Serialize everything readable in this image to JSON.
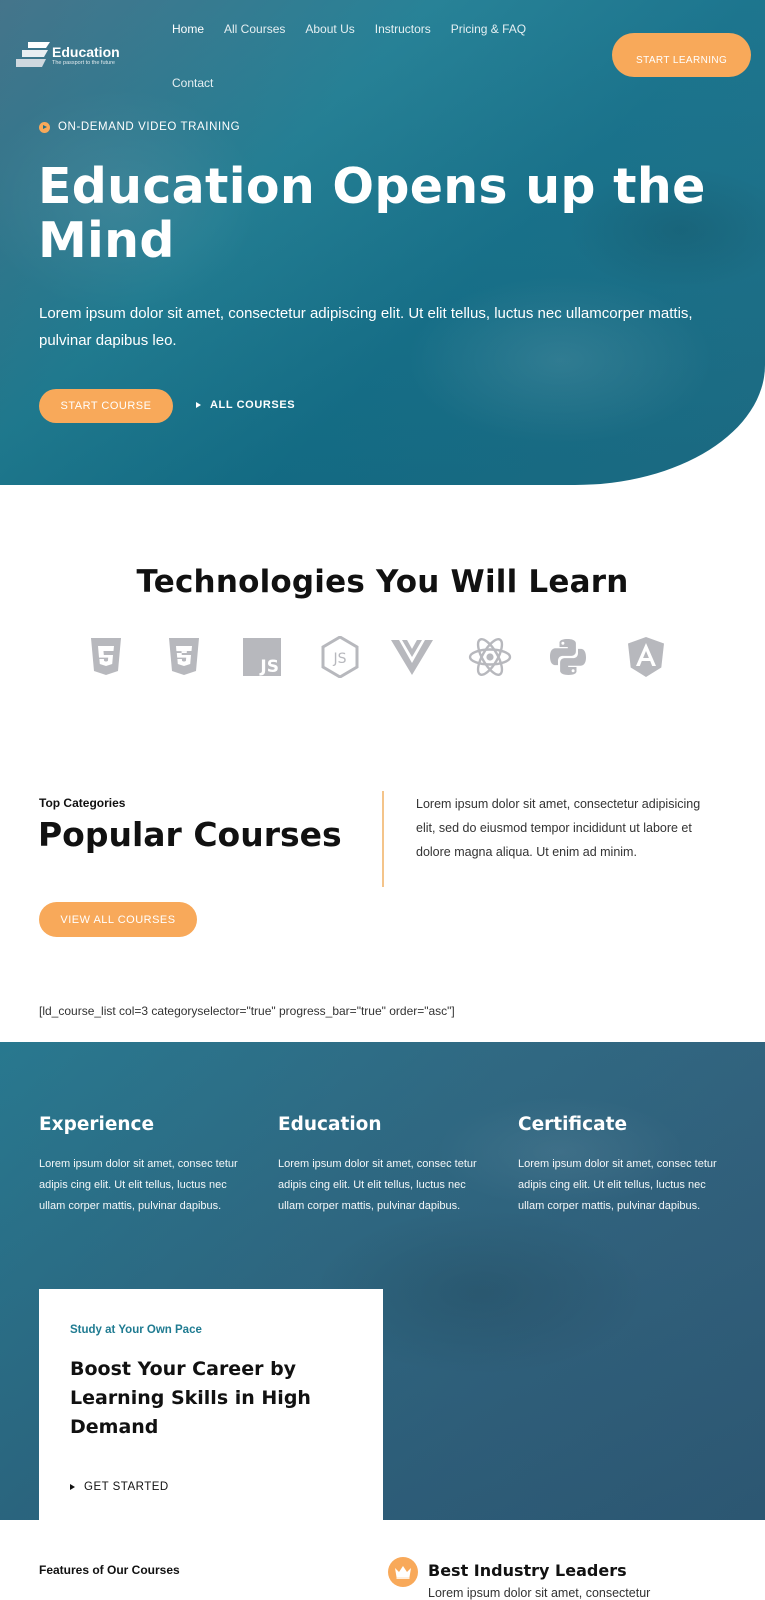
{
  "brand": {
    "name": "Education",
    "tagline": "The passport to the future"
  },
  "nav": {
    "items": [
      "Home",
      "All Courses",
      "About Us",
      "Instructors",
      "Pricing & FAQ"
    ],
    "items_row2": [
      "Contact"
    ],
    "active": "Home"
  },
  "header": {
    "cta_label": "START LEARNING"
  },
  "hero": {
    "eyebrow": "ON-DEMAND VIDEO TRAINING",
    "title": "Education Opens up the Mind",
    "description": "Lorem ipsum dolor sit amet, consectetur adipiscing elit. Ut elit tellus, luctus nec ullamcorper mattis, pulvinar dapibus leo.",
    "primary_button": "START COURSE",
    "secondary_link": "ALL COURSES"
  },
  "technologies": {
    "title": "Technologies You Will Learn",
    "icons": [
      "html5-icon",
      "css3-icon",
      "javascript-icon",
      "nodejs-icon",
      "vuejs-icon",
      "react-icon",
      "python-icon",
      "angular-icon"
    ]
  },
  "popular": {
    "eyebrow": "Top Categories",
    "title": "Popular Courses",
    "description": "Lorem ipsum dolor sit amet, consectetur adipisicing elit, sed do eiusmod tempor incididunt ut labore et dolore magna aliqua. Ut enim ad minim.",
    "button": "VIEW ALL COURSES",
    "shortcode": "[ld_course_list col=3 categoryselector=\"true\" progress_bar=\"true\" order=\"asc\"]"
  },
  "features": [
    {
      "title": "Experience",
      "text": "Lorem ipsum dolor sit amet, consec tetur adipis cing elit. Ut elit tellus, luctus nec ullam corper mattis, pulvinar dapibus."
    },
    {
      "title": "Education",
      "text": "Lorem ipsum dolor sit amet, consec tetur adipis cing elit. Ut elit tellus, luctus nec ullam corper mattis, pulvinar dapibus."
    },
    {
      "title": "Certificate",
      "text": "Lorem ipsum dolor sit amet, consec tetur adipis cing elit. Ut elit tellus, luctus nec ullam corper mattis, pulvinar dapibus."
    }
  ],
  "career_card": {
    "eyebrow": "Study at Your Own Pace",
    "title": "Boost Your Career by Learning Skills in High Demand",
    "link": "GET STARTED"
  },
  "bottom": {
    "eyebrow": "Features of Our Courses",
    "leader_title": "Best Industry Leaders",
    "leader_text": "Lorem ipsum dolor sit amet, consectetur"
  },
  "colors": {
    "accent": "#f8a95a",
    "hero_teal": "#1f7d93",
    "band_blue": "#2d5f7c",
    "card_eyebrow": "#1f7b91",
    "tech_icon_gray": "#b7b8bd"
  }
}
